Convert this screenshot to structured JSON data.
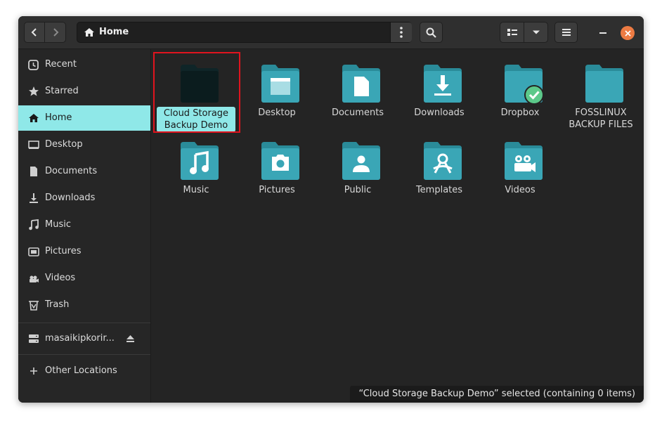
{
  "header": {
    "path_label": "Home"
  },
  "sidebar": {
    "items": [
      {
        "label": "Recent",
        "icon": "clock-icon"
      },
      {
        "label": "Starred",
        "icon": "star-icon"
      },
      {
        "label": "Home",
        "icon": "home-icon",
        "active": true
      },
      {
        "label": "Desktop",
        "icon": "desktop-icon"
      },
      {
        "label": "Documents",
        "icon": "document-icon"
      },
      {
        "label": "Downloads",
        "icon": "download-icon"
      },
      {
        "label": "Music",
        "icon": "music-icon"
      },
      {
        "label": "Pictures",
        "icon": "picture-icon"
      },
      {
        "label": "Videos",
        "icon": "video-icon"
      },
      {
        "label": "Trash",
        "icon": "trash-icon"
      }
    ],
    "drive": {
      "label": "masaikipkorir...",
      "icon": "drive-icon"
    },
    "other_locations": {
      "label": "Other Locations",
      "icon": "plus-icon"
    }
  },
  "files": [
    {
      "name": "Cloud Storage Backup Demo",
      "icon": "folder-icon",
      "selected": true
    },
    {
      "name": "Desktop",
      "icon": "folder-desktop-icon"
    },
    {
      "name": "Documents",
      "icon": "folder-documents-icon"
    },
    {
      "name": "Downloads",
      "icon": "folder-downloads-icon"
    },
    {
      "name": "Dropbox",
      "icon": "folder-dropbox-icon"
    },
    {
      "name": "FOSSLINUX BACKUP FILES",
      "icon": "folder-icon"
    },
    {
      "name": "Music",
      "icon": "folder-music-icon"
    },
    {
      "name": "Pictures",
      "icon": "folder-pictures-icon"
    },
    {
      "name": "Public",
      "icon": "folder-public-icon"
    },
    {
      "name": "Templates",
      "icon": "folder-templates-icon"
    },
    {
      "name": "Videos",
      "icon": "folder-videos-icon"
    }
  ],
  "status": {
    "text": "“Cloud Storage Backup Demo” selected  (containing 0 items)"
  },
  "colors": {
    "accent": "#8fe8e8",
    "folder": "#3aa6b6",
    "selection_outline": "#e0141e",
    "close": "#ed7b43"
  }
}
